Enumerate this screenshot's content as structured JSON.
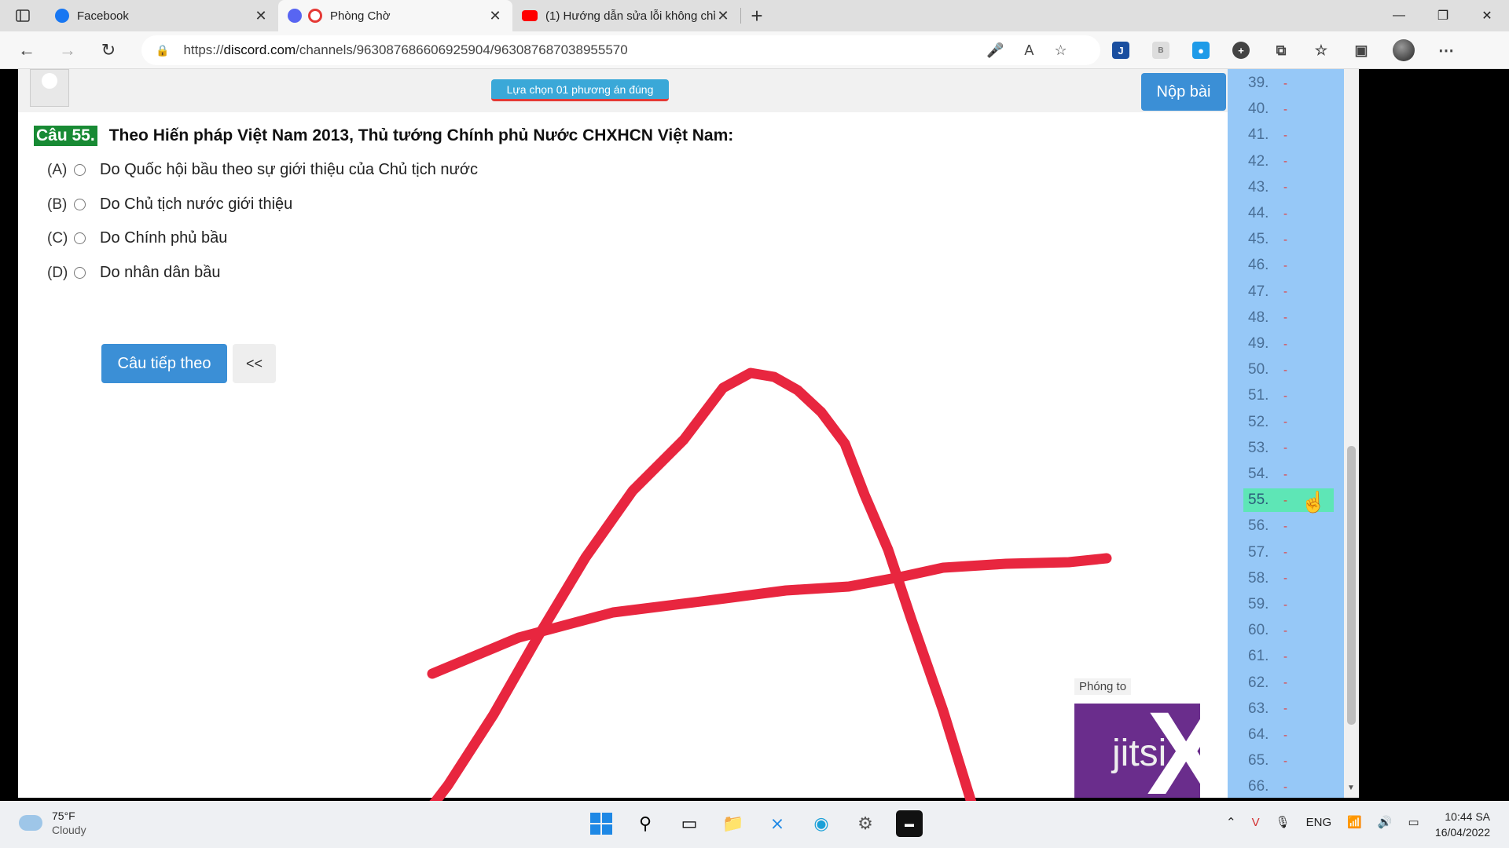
{
  "browser": {
    "tabs": [
      {
        "title": "Facebook",
        "favicon": "facebook-icon",
        "color": "#1877f2",
        "active": false
      },
      {
        "title": "Phòng Chờ",
        "favicon": "record-icon",
        "color": "#e53935",
        "active": true
      },
      {
        "title": "(1) Hướng dẫn sửa lỗi không chỉ",
        "favicon": "youtube-icon",
        "color": "#ff0000",
        "active": false
      }
    ],
    "new_tab": "+",
    "url_prefix": "https://",
    "url_domain": "discord.com",
    "url_path": "/channels/963087686606925904/963087687038955570"
  },
  "quiz": {
    "instruction_pill": "Lựa chọn 01 phương án đúng",
    "submit_label": "Nộp bài",
    "question_number": "Câu 55.",
    "question_text": "Theo Hiến pháp Việt Nam 2013, Thủ tướng Chính phủ Nước CHXHCN Việt Nam:",
    "options": [
      {
        "label": "(A)",
        "text": "Do Quốc hội bầu theo sự giới thiệu của Chủ tịch nước"
      },
      {
        "label": "(B)",
        "text": "Do Chủ tịch nước giới thiệu"
      },
      {
        "label": "(C)",
        "text": "Do Chính phủ bầu"
      },
      {
        "label": "(D)",
        "text": "Do nhân dân bầu"
      }
    ],
    "next_label": "Câu tiếp theo",
    "back_label": "<<",
    "navigator": [
      {
        "n": "39.",
        "a": "-"
      },
      {
        "n": "40.",
        "a": "-"
      },
      {
        "n": "41.",
        "a": "-"
      },
      {
        "n": "42.",
        "a": "-"
      },
      {
        "n": "43.",
        "a": "-"
      },
      {
        "n": "44.",
        "a": "-"
      },
      {
        "n": "45.",
        "a": "-"
      },
      {
        "n": "46.",
        "a": "-"
      },
      {
        "n": "47.",
        "a": "-"
      },
      {
        "n": "48.",
        "a": "-"
      },
      {
        "n": "49.",
        "a": "-"
      },
      {
        "n": "50.",
        "a": "-"
      },
      {
        "n": "51.",
        "a": "-"
      },
      {
        "n": "52.",
        "a": "-"
      },
      {
        "n": "53.",
        "a": "-"
      },
      {
        "n": "54.",
        "a": "-"
      },
      {
        "n": "55.",
        "a": "-",
        "current": true
      },
      {
        "n": "56.",
        "a": "-"
      },
      {
        "n": "57.",
        "a": "-"
      },
      {
        "n": "58.",
        "a": "-"
      },
      {
        "n": "59.",
        "a": "-"
      },
      {
        "n": "60.",
        "a": "-"
      },
      {
        "n": "61.",
        "a": "-"
      },
      {
        "n": "62.",
        "a": "-"
      },
      {
        "n": "63.",
        "a": "-"
      },
      {
        "n": "64.",
        "a": "-"
      },
      {
        "n": "65.",
        "a": "-"
      },
      {
        "n": "66.",
        "a": "-"
      }
    ]
  },
  "video": {
    "label": "Phóng to",
    "logo_text": "jitsi"
  },
  "drawing": {
    "color": "#e8263f"
  },
  "taskbar": {
    "temperature": "75°F",
    "condition": "Cloudy",
    "language": "ENG",
    "time": "10:44 SA",
    "date": "16/04/2022"
  }
}
